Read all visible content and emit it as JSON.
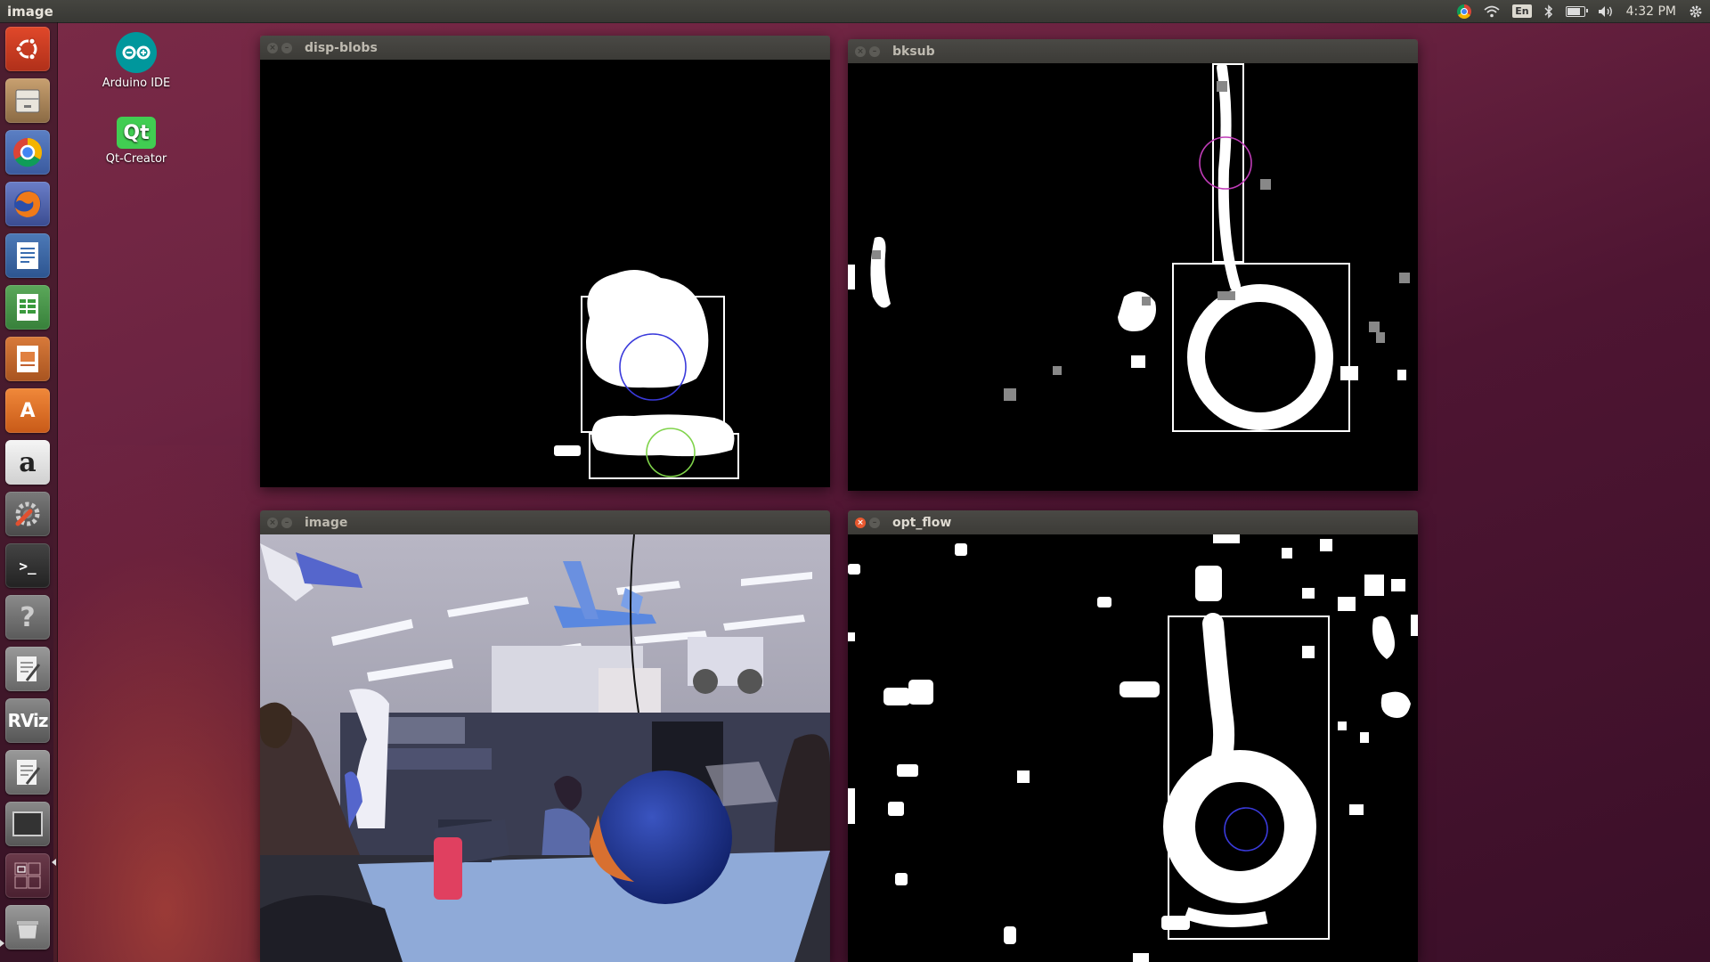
{
  "top_panel": {
    "app_title": "image",
    "language": "En",
    "clock": "4:32 PM",
    "icons": [
      "chrome-icon",
      "wifi-icon",
      "language-indicator",
      "bluetooth-icon",
      "battery-icon",
      "volume-icon",
      "settings-gear-icon"
    ]
  },
  "launcher": {
    "items": [
      {
        "name": "ubuntu-dash",
        "icon": "ubuntu-logo-icon"
      },
      {
        "name": "files",
        "icon": "file-cabinet-icon"
      },
      {
        "name": "chrome",
        "icon": "chrome-icon"
      },
      {
        "name": "firefox",
        "icon": "firefox-icon"
      },
      {
        "name": "writer",
        "icon": "libreoffice-writer-icon"
      },
      {
        "name": "calc",
        "icon": "libreoffice-calc-icon"
      },
      {
        "name": "impress",
        "icon": "libreoffice-impress-icon"
      },
      {
        "name": "software-center",
        "icon": "shopping-bag-icon",
        "glyph": "A"
      },
      {
        "name": "amazon",
        "icon": "amazon-icon",
        "glyph": "a"
      },
      {
        "name": "system-settings",
        "icon": "wrench-gear-icon"
      },
      {
        "name": "terminal",
        "icon": "terminal-icon",
        "glyph": ">_"
      },
      {
        "name": "help",
        "icon": "question-icon",
        "glyph": "?"
      },
      {
        "name": "text-editor",
        "icon": "text-editor-icon"
      },
      {
        "name": "rviz",
        "icon": "rviz-icon",
        "glyph": "RViz"
      },
      {
        "name": "text-editor-2",
        "icon": "text-editor-icon"
      },
      {
        "name": "window",
        "icon": "window-icon"
      },
      {
        "name": "workspaces",
        "icon": "workspace-switcher-icon"
      },
      {
        "name": "trash",
        "icon": "trash-icon"
      }
    ]
  },
  "desktop": {
    "icons": [
      {
        "label": "Arduino IDE",
        "icon": "arduino-icon"
      },
      {
        "label": "Qt-Creator",
        "icon": "qt-creator-icon",
        "glyph": "Qt"
      }
    ]
  },
  "windows": {
    "disp_blobs": {
      "title": "disp-blobs"
    },
    "bksub": {
      "title": "bksub"
    },
    "image": {
      "title": "image"
    },
    "opt_flow": {
      "title": "opt_flow"
    }
  },
  "colors": {
    "panel": "#3c3b37",
    "close_active": "#e8582f",
    "circle_blue": "#3a3adb",
    "circle_green": "#7fd34a",
    "circle_magenta": "#c03cb8"
  }
}
